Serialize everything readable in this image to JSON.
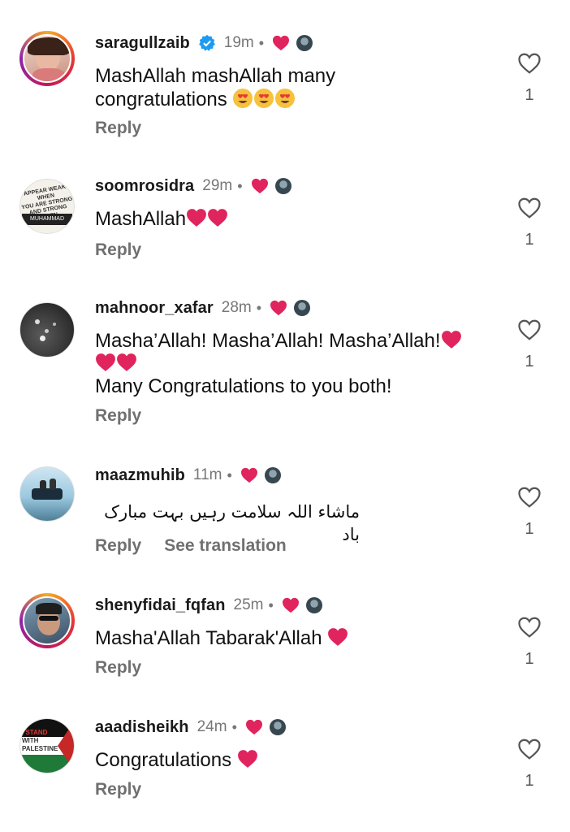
{
  "colors": {
    "heart": "#e0245e",
    "verified": "#1d9bf0",
    "muted": "#707070"
  },
  "icons": {
    "like": "heart-outline-icon",
    "verified": "verified-badge-icon",
    "creator_like": "red-heart-icon"
  },
  "comments": [
    {
      "username": "saragullzaib",
      "verified": true,
      "time": "19m",
      "text": [
        "MashAllah mashAllah many",
        "congratulations 😍😍😍"
      ],
      "reply": "Reply",
      "likes": "1"
    },
    {
      "username": "soomrosidra",
      "time": "29m",
      "text": [
        "MashAllah❤️❤️"
      ],
      "reply": "Reply",
      "likes": "1",
      "avatar_text": [
        "APPEAR WEAK WHEN",
        "YOU ARE STRONG",
        "AND STRONG WHEN",
        "MUHAMMAD"
      ]
    },
    {
      "username": "mahnoor_xafar",
      "time": "28m",
      "text": [
        "Masha’Allah! Masha’Allah! Masha’Allah!❤️",
        "❤️❤️",
        "Many Congratulations to you both!"
      ],
      "reply": "Reply",
      "likes": "1"
    },
    {
      "username": "maazmuhib",
      "time": "11m",
      "text": [
        "ماشاء اللہ سلامت رہیں بہت مبارک باد"
      ],
      "reply": "Reply",
      "see_translation": "See translation",
      "likes": "1"
    },
    {
      "username": "shenyfidai_fqfan",
      "time": "25m",
      "text": [
        "Masha'Allah Tabarak'Allah ❤️"
      ],
      "reply": "Reply",
      "likes": "1"
    },
    {
      "username": "aaadisheikh",
      "time": "24m",
      "text": [
        "Congratulations ❤️"
      ],
      "reply": "Reply",
      "likes": "1",
      "avatar_text": [
        "I STAND",
        "WITH",
        "PALESTINE"
      ]
    }
  ]
}
